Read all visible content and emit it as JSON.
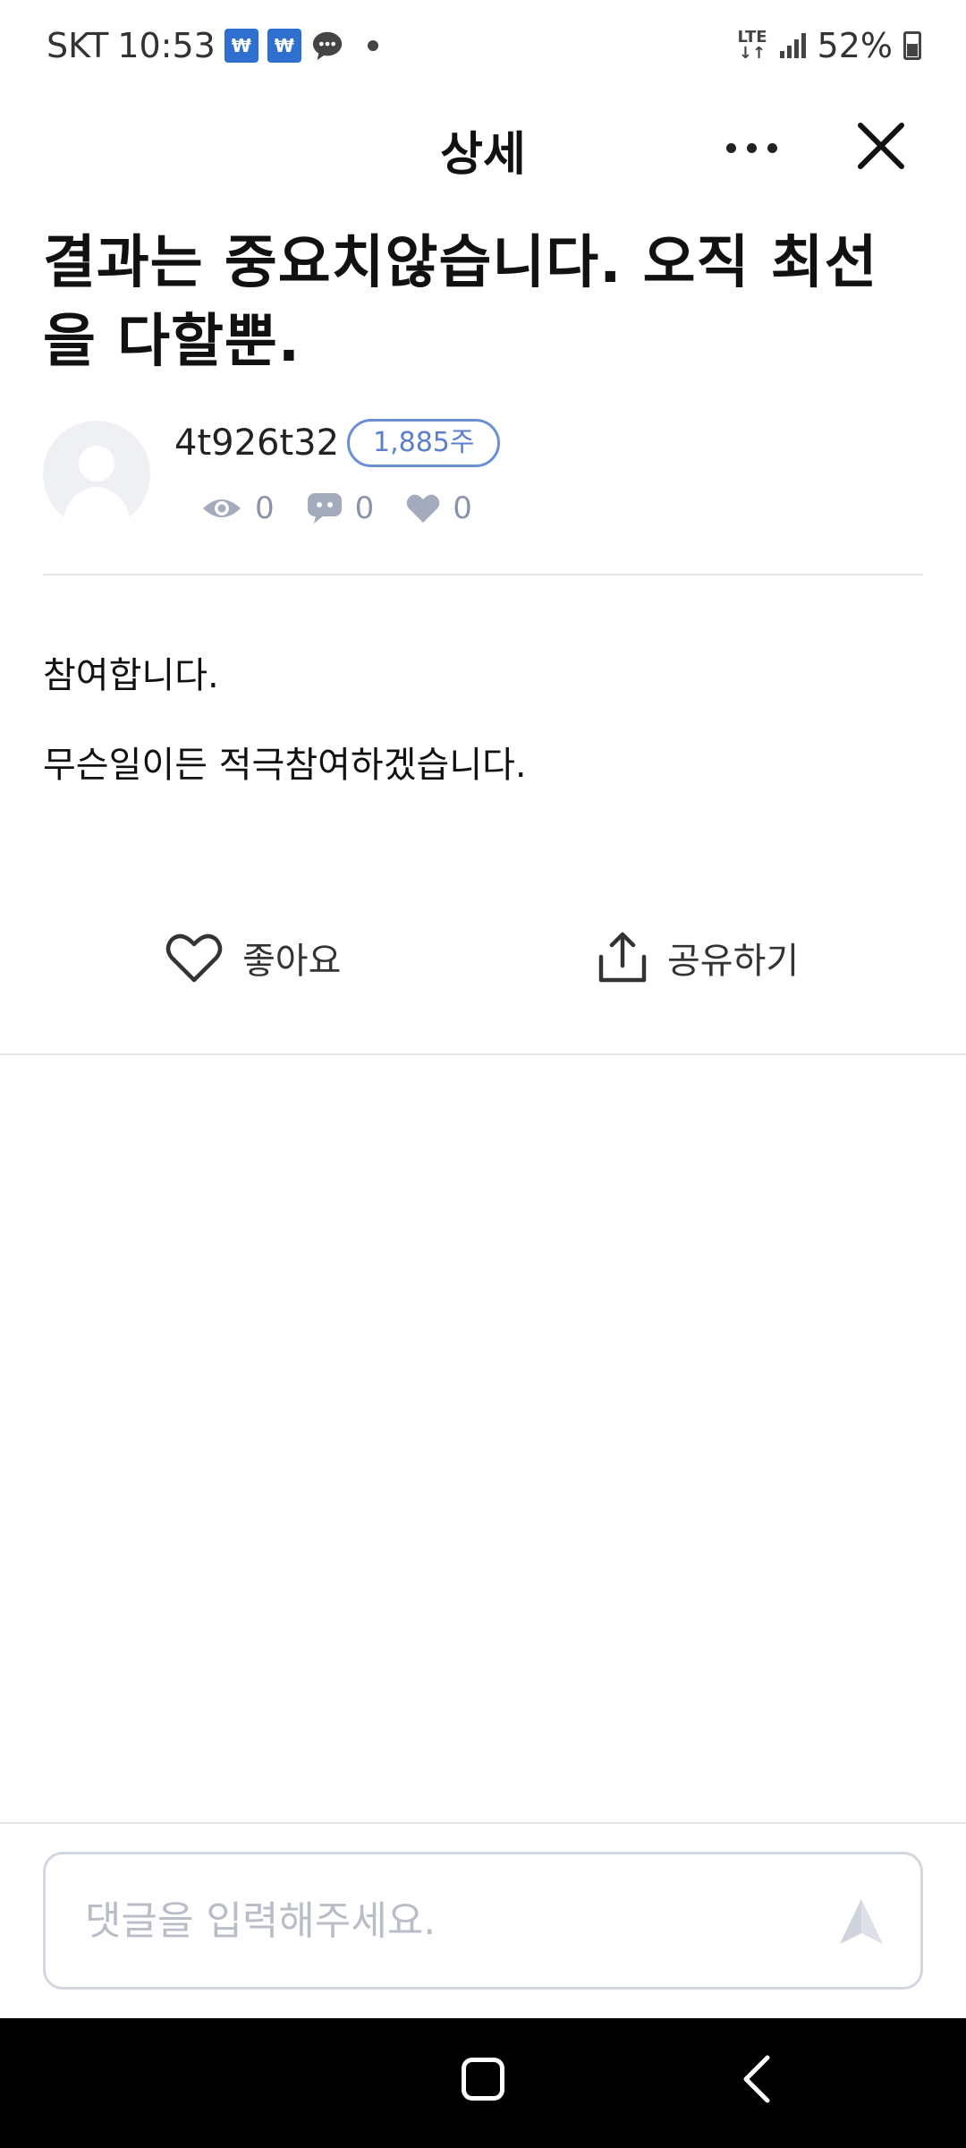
{
  "status_bar": {
    "carrier": "SKT",
    "time": "10:53",
    "network": "LTE",
    "battery": "52%"
  },
  "header": {
    "title": "상세"
  },
  "post": {
    "title": "결과는 중요치않습니다. 오직 최선을 다할뿐.",
    "author": "4t926t32",
    "badge": "1,885주",
    "stats": {
      "views": "0",
      "comments": "0",
      "likes": "0"
    },
    "body": [
      "참여합니다.",
      "무슨일이든 적극참여하겠습니다."
    ]
  },
  "actions": {
    "like_label": "좋아요",
    "share_label": "공유하기"
  },
  "comment": {
    "placeholder": "댓글을 입력해주세요."
  }
}
